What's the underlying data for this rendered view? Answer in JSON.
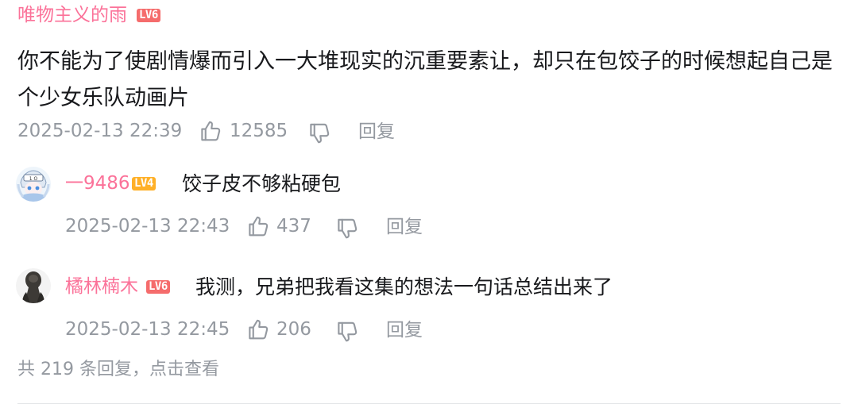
{
  "main_comment": {
    "username": "唯物主义的雨",
    "level": "LV6",
    "text": "你不能为了使剧情爆而引入一大堆现实的沉重要素让，却只在包饺子的时候想起自己是个少女乐队动画片",
    "timestamp": "2025-02-13 22:39",
    "likes": "12585",
    "reply_label": "回复"
  },
  "replies": [
    {
      "username": "一9486",
      "level": "LV4",
      "text": "饺子皮不够粘硬包",
      "timestamp": "2025-02-13 22:43",
      "likes": "437",
      "reply_label": "回复",
      "avatar_icon": "anime-avatar-icon"
    },
    {
      "username": "橘林楠木",
      "level": "LV6",
      "text": "我测，兄弟把我看这集的想法一句话总结出来了",
      "timestamp": "2025-02-13 22:45",
      "likes": "206",
      "reply_label": "回复",
      "avatar_icon": "dark-figure-avatar-icon"
    }
  ],
  "footer": {
    "more_replies": "共 219 条回复，点击查看"
  },
  "icons": {
    "like": "thumbs-up-icon",
    "dislike": "thumbs-down-icon"
  },
  "colors": {
    "username": "#fb7299",
    "level6": "#f56c6c",
    "level4": "#ffb027",
    "meta": "#9499a0",
    "text": "#18191c"
  }
}
